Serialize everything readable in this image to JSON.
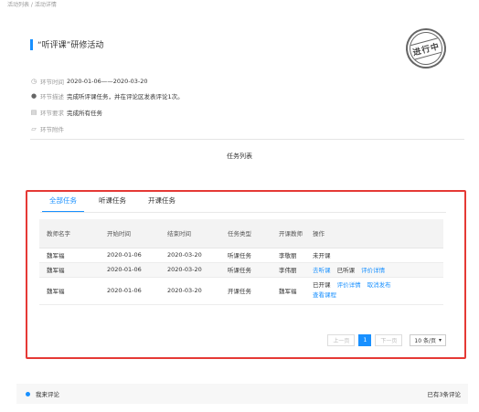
{
  "breadcrumb": "活动列表 / 活动详情",
  "activity": {
    "title": "“听评课”研修活动",
    "stamp": "进行中"
  },
  "info": {
    "time_label": "环节时间",
    "time_value": "2020-01-06——2020-03-20",
    "desc_label": "环节描述",
    "desc_value": "完成听评课任务，并在评论区发表评论1次。",
    "req_label": "环节要求",
    "req_value": "完成所有任务",
    "attach_label": "环节附件"
  },
  "task_list_title": "任务列表",
  "tabs": [
    "全部任务",
    "听课任务",
    "开课任务"
  ],
  "table": {
    "headers": [
      "教师名字",
      "开始时间",
      "结束时间",
      "任务类型",
      "开课教师",
      "操作"
    ],
    "rows": [
      {
        "teacher": "魏军福",
        "start": "2020-01-06",
        "end": "2020-03-20",
        "type": "听课任务",
        "host": "李敬丽",
        "ops": [
          {
            "text": "未开课",
            "link": false
          }
        ]
      },
      {
        "teacher": "魏军福",
        "start": "2020-01-06",
        "end": "2020-03-20",
        "type": "听课任务",
        "host": "李伟丽",
        "ops": [
          {
            "text": "去听课",
            "link": true
          },
          {
            "text": "已听课",
            "link": false
          },
          {
            "text": "评价详情",
            "link": true
          }
        ]
      },
      {
        "teacher": "魏军福",
        "start": "2020-01-06",
        "end": "2020-03-20",
        "type": "开课任务",
        "host": "魏军福",
        "ops": [
          {
            "text": "已开课",
            "link": false
          },
          {
            "text": "评价详情",
            "link": true
          },
          {
            "text": "取消发布",
            "link": true
          },
          {
            "text": "查看课程",
            "link": true
          }
        ]
      }
    ]
  },
  "pager": {
    "prev": "上一页",
    "current": "1",
    "next": "下一页",
    "page_size": "10 条/页"
  },
  "footer": {
    "my_comment": "我来评论",
    "count": "已有3条评论"
  },
  "colors": {
    "accent": "#1890ff",
    "highlight_border": "#e53935"
  }
}
